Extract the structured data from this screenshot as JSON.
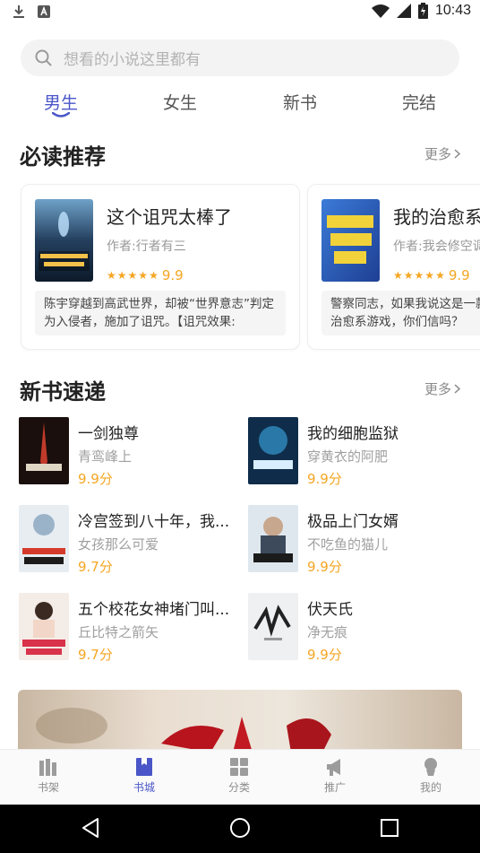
{
  "status_bar": {
    "time": "10:43",
    "left_icons": [
      "download-icon",
      "app-notification-icon"
    ],
    "right_icons": [
      "wifi-icon",
      "cell-signal-icon",
      "battery-icon"
    ]
  },
  "search": {
    "placeholder": "想看的小说这里都有"
  },
  "tabs": [
    {
      "label": "男生",
      "active": true
    },
    {
      "label": "女生",
      "active": false
    },
    {
      "label": "新书",
      "active": false
    },
    {
      "label": "完结",
      "active": false
    }
  ],
  "must_read": {
    "title": "必读推荐",
    "more": "更多",
    "cards": [
      {
        "title": "这个诅咒太棒了",
        "author": "作者:行者有三",
        "rating": 9.9,
        "score": "9.9",
        "description": "陈宇穿越到高武世界，却被“世界意志”判定为入侵者，施加了诅咒。【诅咒效果:"
      },
      {
        "title": "我的治愈系游戏",
        "author": "作者:我会修空调",
        "rating": 9.9,
        "score": "9.9",
        "description": "警察同志，如果我说这是一款治愈系游戏，你们信吗？"
      }
    ]
  },
  "new_books": {
    "title": "新书速递",
    "more": "更多",
    "books": [
      {
        "title": "一剑独尊",
        "author": "青鸾峰上",
        "score": "9.9分"
      },
      {
        "title": "我的细胞监狱",
        "author": "穿黄衣的阿肥",
        "score": "9.9分"
      },
      {
        "title": "冷宫签到八十年，我...",
        "author": "女孩那么可爱",
        "score": "9.7分"
      },
      {
        "title": "极品上门女婿",
        "author": "不吃鱼的猫儿",
        "score": "9.9分"
      },
      {
        "title": "五个校花女神堵门叫...",
        "author": "丘比特之箭矢",
        "score": "9.7分"
      },
      {
        "title": "伏天氏",
        "author": "净无痕",
        "score": "9.9分"
      }
    ]
  },
  "bottom_nav": [
    {
      "label": "书架",
      "icon": "bookshelf-icon",
      "active": false
    },
    {
      "label": "书城",
      "icon": "bookstore-icon",
      "active": true
    },
    {
      "label": "分类",
      "icon": "category-grid-icon",
      "active": false
    },
    {
      "label": "推广",
      "icon": "megaphone-icon",
      "active": false
    },
    {
      "label": "我的",
      "icon": "profile-icon",
      "active": false
    }
  ],
  "system_nav": [
    "back-icon",
    "home-icon",
    "recents-icon"
  ],
  "colors": {
    "accent": "#4a56c8",
    "score": "#f5a623",
    "muted": "#999999"
  }
}
